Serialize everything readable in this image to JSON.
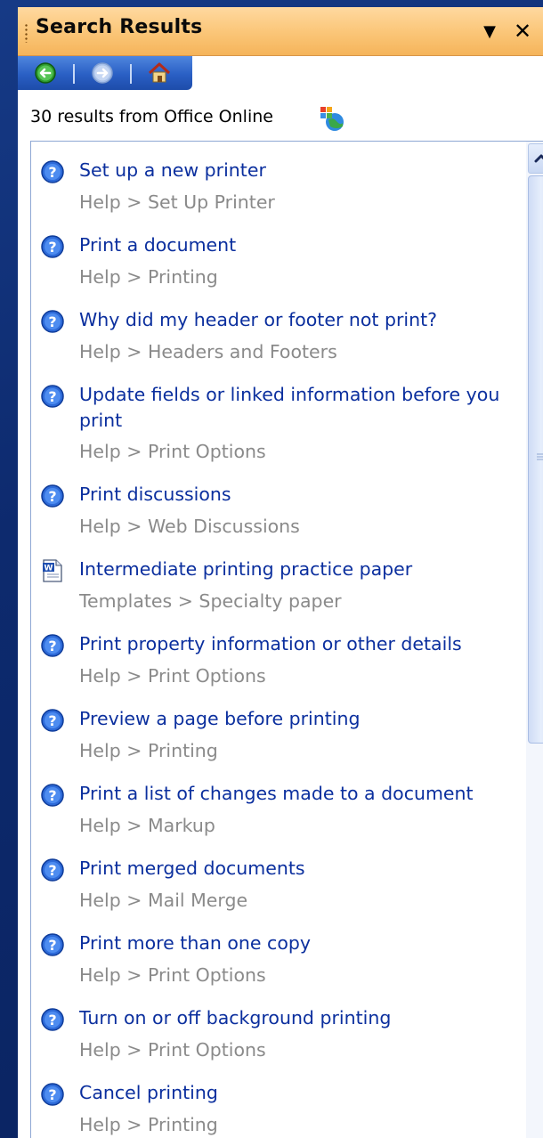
{
  "pane": {
    "title": "Search Results",
    "dropdown_icon": "chevron-down-icon",
    "close_icon": "close-icon",
    "accent": "#fbc77a"
  },
  "nav": {
    "back_icon": "back-arrow-icon",
    "forward_icon": "forward-arrow-icon",
    "home_icon": "home-icon"
  },
  "summary": {
    "count_text": "30 results from Office Online"
  },
  "results": [
    {
      "icon": "help-icon",
      "title": "Set up a new printer",
      "crumb": "Help > Set Up Printer"
    },
    {
      "icon": "help-icon",
      "title": "Print a document",
      "crumb": "Help > Printing"
    },
    {
      "icon": "help-icon",
      "title": "Why did my header or footer not print?",
      "crumb": "Help > Headers and Footers"
    },
    {
      "icon": "help-icon",
      "title": "Update fields or linked information before you print",
      "crumb": "Help > Print Options"
    },
    {
      "icon": "help-icon",
      "title": "Print discussions",
      "crumb": "Help > Web Discussions"
    },
    {
      "icon": "word-template-icon",
      "title": "Intermediate printing practice paper",
      "crumb": "Templates > Specialty paper"
    },
    {
      "icon": "help-icon",
      "title": "Print property information or other details",
      "crumb": "Help > Print Options"
    },
    {
      "icon": "help-icon",
      "title": "Preview a page before printing",
      "crumb": "Help > Printing"
    },
    {
      "icon": "help-icon",
      "title": "Print a list of changes made to a document",
      "crumb": "Help > Markup"
    },
    {
      "icon": "help-icon",
      "title": "Print merged documents",
      "crumb": "Help > Mail Merge"
    },
    {
      "icon": "help-icon",
      "title": "Print more than one copy",
      "crumb": "Help > Print Options"
    },
    {
      "icon": "help-icon",
      "title": "Turn on or off background printing",
      "crumb": "Help > Print Options"
    },
    {
      "icon": "help-icon",
      "title": "Cancel printing",
      "crumb": "Help > Printing"
    }
  ]
}
